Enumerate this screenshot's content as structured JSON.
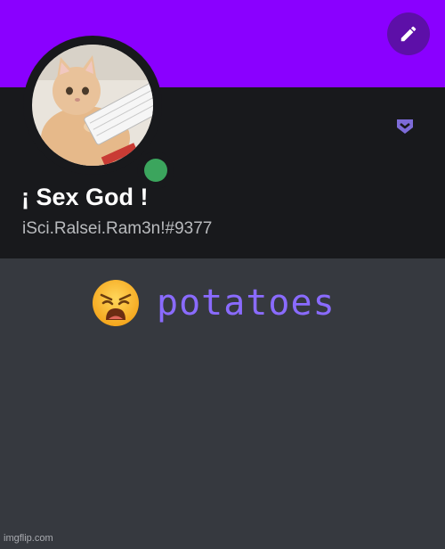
{
  "profile": {
    "display_name": "¡ Sex God !",
    "username": "iSci.Ralsei.Ram3n!#9377",
    "online_status": "online"
  },
  "custom_status": {
    "emoji": "weary-face",
    "text": "potatoes"
  },
  "icons": {
    "edit": "pencil-icon",
    "badge": "hypesquad-chevron-icon",
    "avatar": "cat-at-keyboard-avatar"
  },
  "colors": {
    "banner": "#8a00ff",
    "header_panel": "#18191c",
    "body": "#36393f",
    "status_online": "#3ba55d",
    "status_text": "#8a6bff"
  },
  "watermark": "imgflip.com"
}
